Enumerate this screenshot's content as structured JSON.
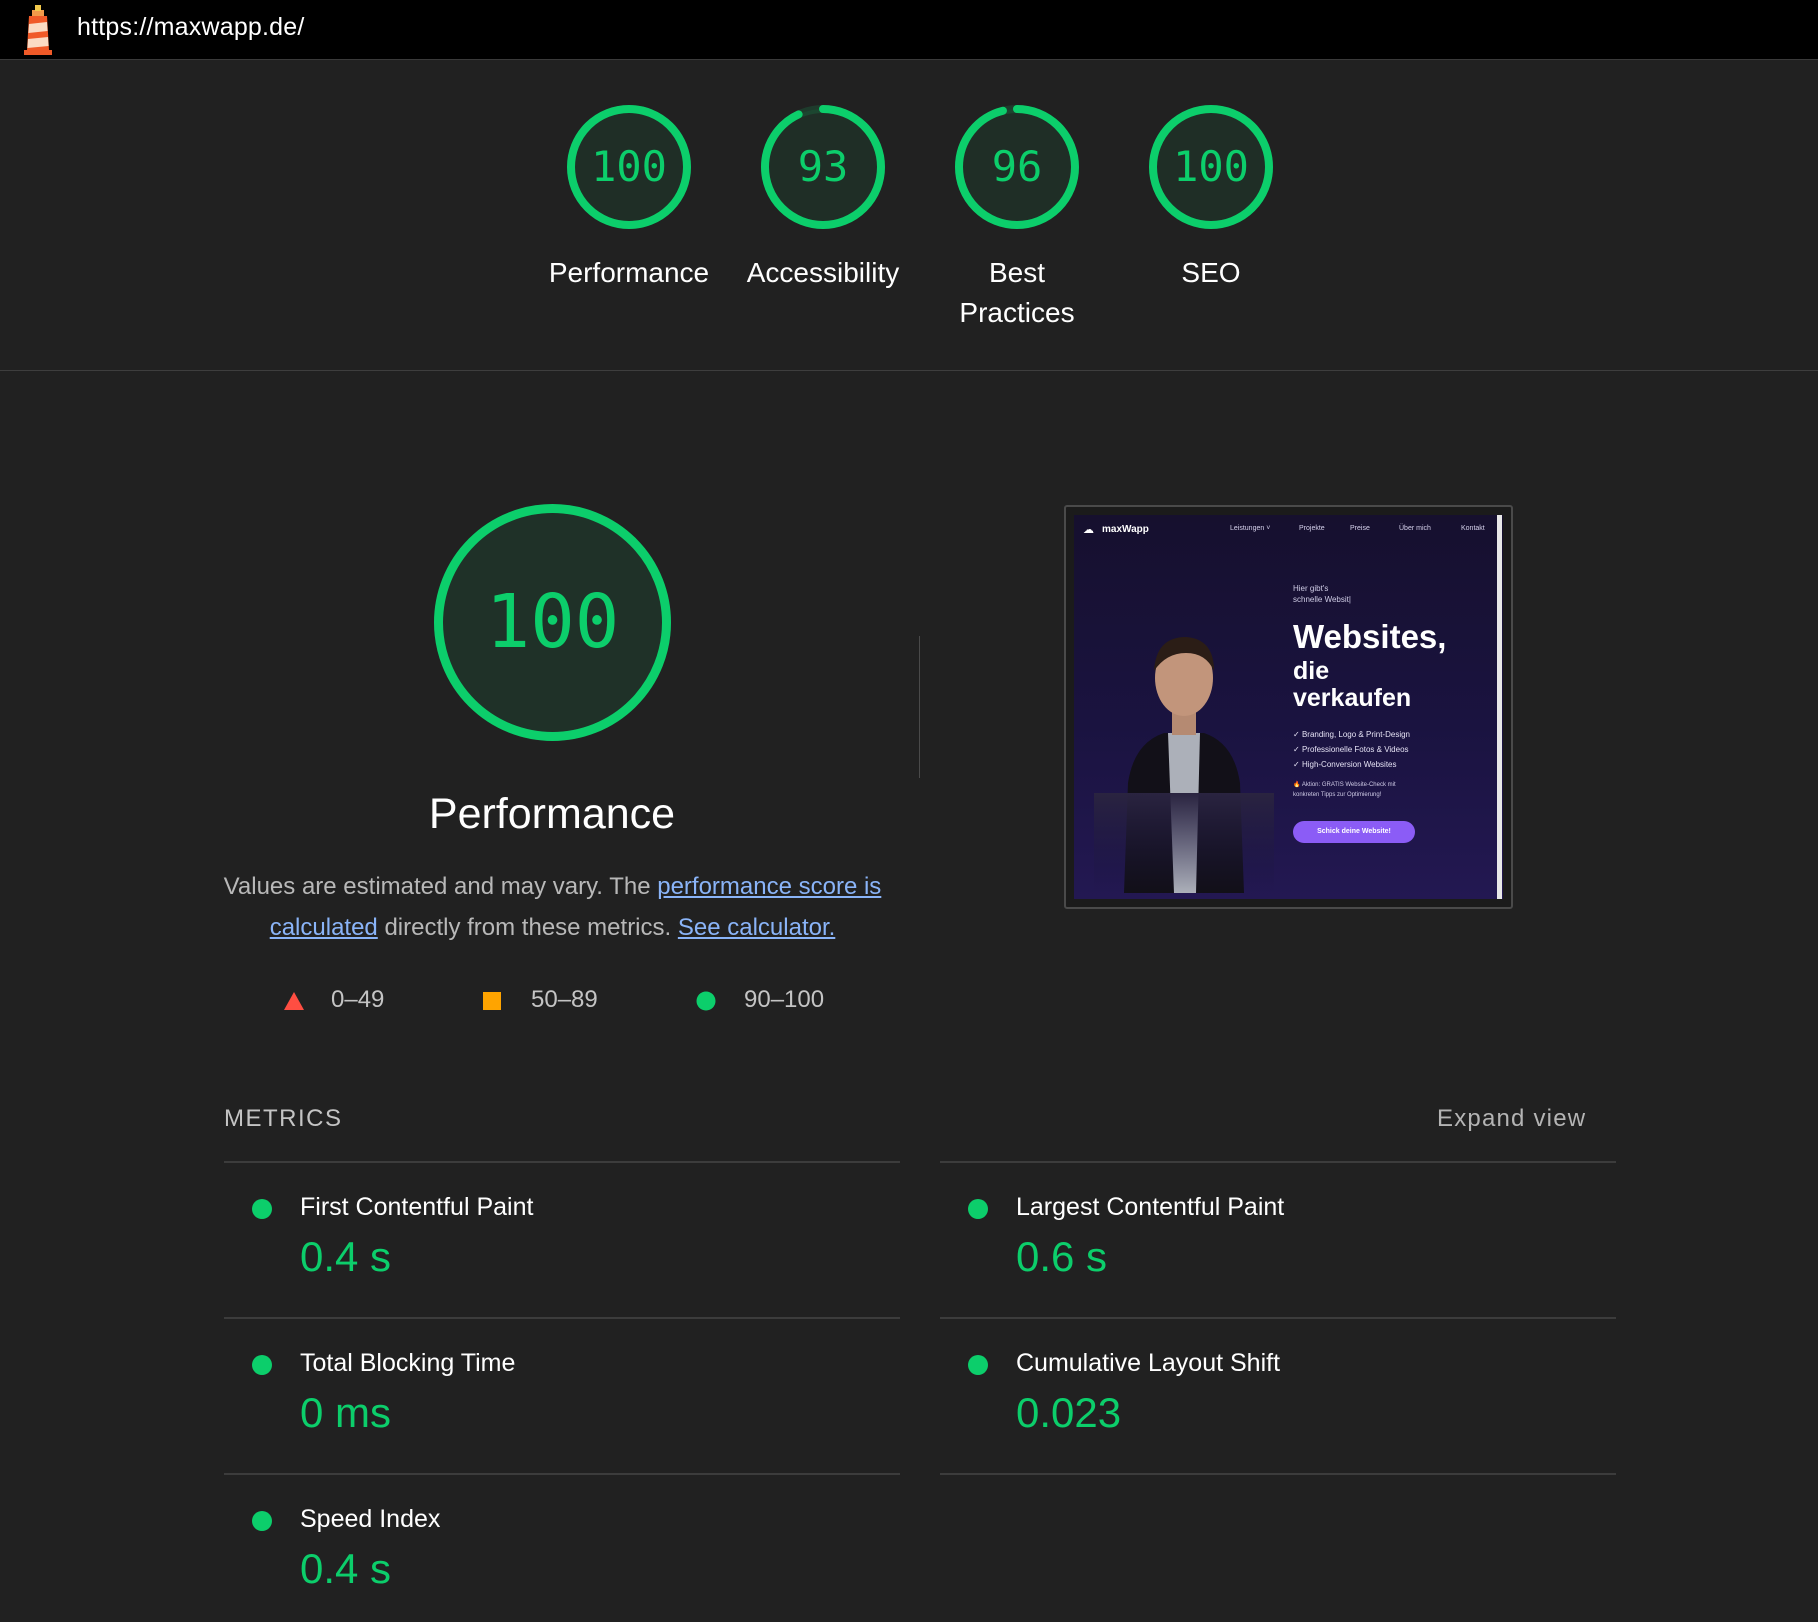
{
  "url": "https://maxwapp.de/",
  "colors": {
    "pass": "#0cce6b",
    "average": "#ffa400",
    "fail": "#ff4e42",
    "link": "#8ab4f8",
    "background": "#212121",
    "topbar": "#000000"
  },
  "categories": [
    {
      "score": "100",
      "score_value": 100,
      "label": "Performance"
    },
    {
      "score": "93",
      "score_value": 93,
      "label": "Accessibility"
    },
    {
      "score": "96",
      "score_value": 96,
      "label": "Best Practices"
    },
    {
      "score": "100",
      "score_value": 100,
      "label": "SEO"
    }
  ],
  "performance": {
    "score": "100",
    "score_value": 100,
    "title": "Performance",
    "desc_prefix": "Values are estimated and may vary. The ",
    "desc_link1": "performance score is calculated",
    "desc_middle": " directly from these metrics. ",
    "desc_link2": "See calculator."
  },
  "legend": [
    {
      "icon": "red-triangle-icon",
      "range": "0–49"
    },
    {
      "icon": "orange-square-icon",
      "range": "50–89"
    },
    {
      "icon": "green-circle-icon",
      "range": "90–100"
    }
  ],
  "thumbnail": {
    "brand": "maxWapp",
    "nav": [
      "Leistungen ˅",
      "Projekte",
      "Preise",
      "Über mich",
      "Kontakt"
    ],
    "small_line1": "Hier gibt's",
    "small_line2": "schnelle Websit|",
    "headline1": "Websites,",
    "headline2": "die",
    "headline3": "verkaufen",
    "bullets": [
      "Branding, Logo & Print-Design",
      "Professionelle Fotos & Videos",
      "High-Conversion Websites"
    ],
    "promo_line1": "Aktion: GRATIS Website-Check mit",
    "promo_line2": "konkreten Tipps zur Optimierung!",
    "cta": "Schick deine Website!"
  },
  "metrics": {
    "title": "METRICS",
    "expand_label": "Expand view",
    "items": [
      {
        "label": "First Contentful Paint",
        "value": "0.4 s"
      },
      {
        "label": "Largest Contentful Paint",
        "value": "0.6 s"
      },
      {
        "label": "Total Blocking Time",
        "value": "0 ms"
      },
      {
        "label": "Cumulative Layout Shift",
        "value": "0.023"
      },
      {
        "label": "Speed Index",
        "value": "0.4 s"
      }
    ]
  }
}
